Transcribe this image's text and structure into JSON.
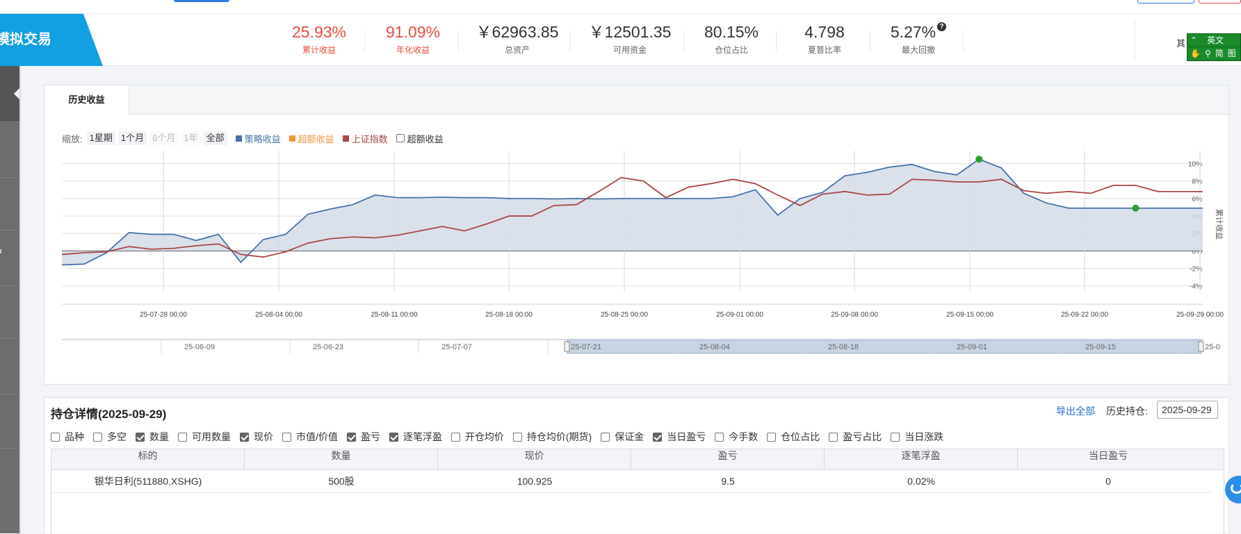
{
  "header": {
    "brand": "模拟交易",
    "stats": [
      {
        "value": "25.93%",
        "label": "累计收益"
      },
      {
        "value": "91.09%",
        "label": "年化收益"
      },
      {
        "value": "￥62963.85",
        "label": "总资产"
      },
      {
        "value": "￥12501.35",
        "label": "可用资金"
      },
      {
        "value": "80.15%",
        "label": "仓位占比"
      },
      {
        "value": "4.798",
        "label": "夏普比率"
      },
      {
        "value": "5.27%",
        "label": "最大回撤"
      }
    ],
    "help_glyph": "?",
    "other_text": "其",
    "translate": {
      "language": "英文",
      "mode": "简",
      "extra": "图"
    }
  },
  "history": {
    "tab": "历史收益",
    "zoom_label": "缩放:",
    "zoom_options": [
      {
        "label": "1星期",
        "disabled": false
      },
      {
        "label": "1个月",
        "disabled": false
      },
      {
        "label": "6个月",
        "disabled": true
      },
      {
        "label": "1年",
        "disabled": true
      },
      {
        "label": "全部",
        "disabled": false
      }
    ],
    "legend": [
      {
        "name": "策略收益",
        "color": "#4572a7"
      },
      {
        "name": "超额收益",
        "color": "#f0953f"
      },
      {
        "name": "上证指数",
        "color": "#aa4643"
      }
    ],
    "excess_checkbox": "超额收益"
  },
  "chart_data": {
    "type": "line",
    "ylabel": "累计收益",
    "y_ticks": [
      "10%",
      "8%",
      "6%",
      "4%",
      "2%",
      "0%",
      "-2%",
      "-4%"
    ],
    "ylim": [
      -4.5,
      11
    ],
    "x_tick_labels": [
      "25-07-28 00:00",
      "25-08-04 00:00",
      "25-08-11 00:00",
      "25-08-18 00:00",
      "25-08-25 00:00",
      "25-09-01 00:00",
      "25-09-08 00:00",
      "25-09-15 00:00",
      "25-09-22 00:00",
      "25-09-29 00:00"
    ],
    "navigator_labels": [
      "25-06-09",
      "25-06-23",
      "25-07-07",
      "25-07-21",
      "25-08-04",
      "25-08-18",
      "25-09-01",
      "25-09-15",
      "25-0"
    ],
    "grid": true,
    "series": [
      {
        "name": "策略收益",
        "color": "#4572a7",
        "fill": "#d4dce8",
        "values": [
          -1.6,
          -1.5,
          -0.2,
          2.1,
          1.9,
          1.9,
          1.2,
          1.9,
          -1.3,
          1.3,
          1.9,
          4.2,
          4.8,
          5.3,
          6.4,
          6.1,
          6.1,
          6.15,
          6.1,
          6.1,
          6.0,
          6.0,
          5.95,
          6.0,
          5.95,
          6.0,
          6.0,
          6.0,
          6.0,
          6.0,
          6.2,
          7.0,
          4.1,
          6.0,
          6.7,
          8.6,
          9.0,
          9.6,
          9.9,
          9.1,
          8.7,
          10.5,
          9.5,
          6.6,
          5.5,
          4.9,
          4.9,
          4.9,
          4.9,
          4.9,
          4.9,
          4.9
        ]
      },
      {
        "name": "上证指数",
        "color": "#aa4643",
        "values": [
          -0.4,
          -0.2,
          -0.1,
          0.5,
          0.2,
          0.3,
          0.6,
          0.8,
          -0.4,
          -0.7,
          -0.1,
          0.9,
          1.4,
          1.6,
          1.5,
          1.8,
          2.3,
          2.8,
          2.3,
          3.1,
          4.0,
          4.0,
          5.2,
          5.3,
          6.8,
          8.4,
          8.0,
          6.1,
          7.3,
          7.7,
          8.2,
          7.7,
          6.4,
          5.2,
          6.5,
          6.8,
          6.4,
          6.5,
          8.2,
          8.1,
          7.9,
          7.9,
          8.2,
          6.9,
          6.6,
          6.8,
          6.6,
          7.5,
          7.5,
          6.8,
          6.8,
          6.8
        ]
      }
    ],
    "markers": [
      {
        "series": "策略收益",
        "index": 41,
        "value": 10.5,
        "color": "#2ca02c"
      },
      {
        "series": "策略收益",
        "index": 48,
        "value": 4.9,
        "color": "#2ca02c"
      }
    ]
  },
  "holdings": {
    "title": "持仓详情(2025-09-29)",
    "export": "导出全部",
    "history_label": "历史持仓:",
    "history_date": "2025-09-29",
    "columns_toggle": [
      {
        "label": "品种",
        "checked": false
      },
      {
        "label": "多空",
        "checked": false
      },
      {
        "label": "数量",
        "checked": true
      },
      {
        "label": "可用数量",
        "checked": false
      },
      {
        "label": "现价",
        "checked": true
      },
      {
        "label": "市值/价值",
        "checked": false
      },
      {
        "label": "盈亏",
        "checked": true
      },
      {
        "label": "逐笔浮盈",
        "checked": true
      },
      {
        "label": "开仓均价",
        "checked": false
      },
      {
        "label": "持仓均价(期货)",
        "checked": false
      },
      {
        "label": "保证金",
        "checked": false
      },
      {
        "label": "当日盈亏",
        "checked": true
      },
      {
        "label": "今手数",
        "checked": false
      },
      {
        "label": "仓位占比",
        "checked": false
      },
      {
        "label": "盈亏占比",
        "checked": false
      },
      {
        "label": "当日涨跌",
        "checked": false
      }
    ],
    "table_headers": [
      "标的",
      "数量",
      "现价",
      "盈亏",
      "逐笔浮盈",
      "当日盈亏"
    ],
    "rows": [
      [
        "银华日利(511880.XSHG)",
        "500股",
        "100.925",
        "9.5",
        "0.02%",
        "0"
      ]
    ]
  }
}
